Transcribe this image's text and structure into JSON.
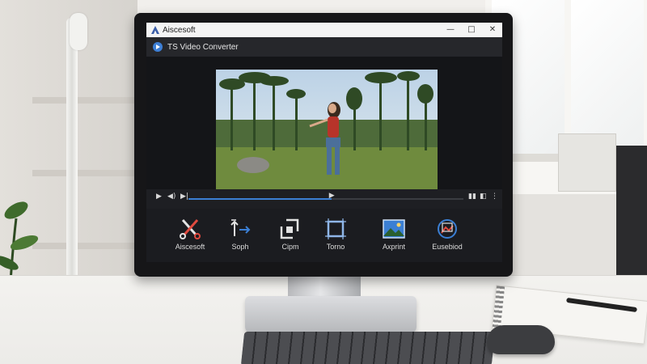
{
  "window": {
    "brand_title": "Aiscesoft",
    "app_title": "TS Video Converter",
    "controls": {
      "minimize": "—",
      "maximize": "□",
      "close": "✕"
    }
  },
  "player": {
    "progress_fraction": 0.52,
    "buttons": [
      "play",
      "volume",
      "next"
    ]
  },
  "toolbar": {
    "items": [
      {
        "label": "Aiscesoft",
        "icon": "scissors-icon"
      },
      {
        "label": "Soph",
        "icon": "sort-arrows-icon"
      },
      {
        "label": "Cipm",
        "icon": "crop-corners-icon"
      },
      {
        "label": "Torno",
        "icon": "frame-icon"
      },
      {
        "label": "Axprint",
        "icon": "landscape-image-icon"
      },
      {
        "label": "Eusebiod",
        "icon": "refresh-image-icon"
      }
    ]
  },
  "colors": {
    "accent": "#3b7fd4",
    "app_bg": "#1e1f23",
    "titlebar": "#f4f4f4"
  }
}
